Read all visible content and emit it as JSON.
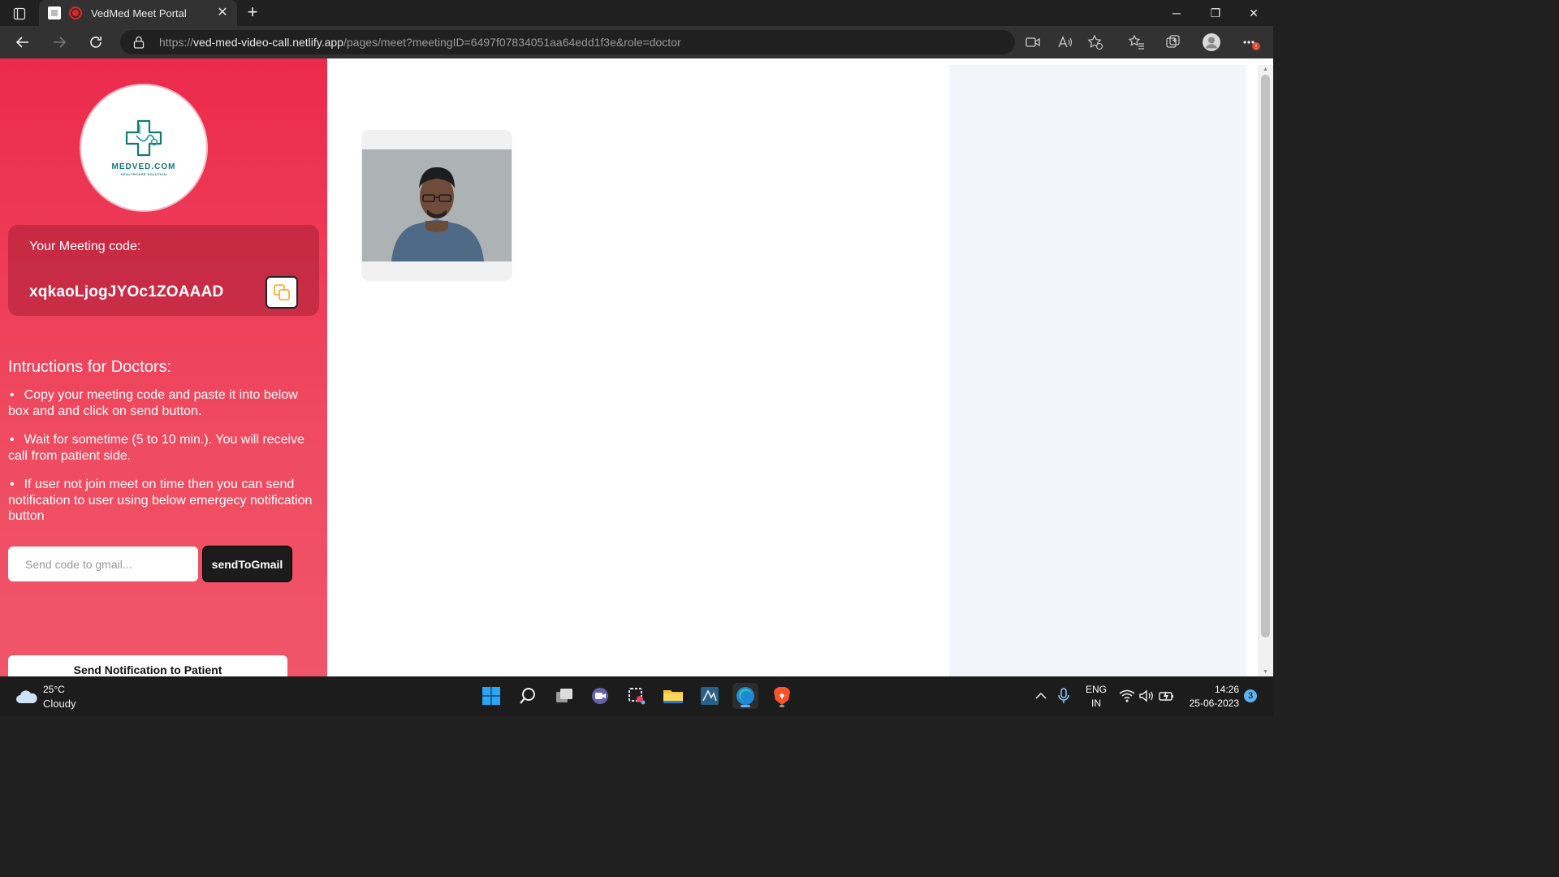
{
  "browser": {
    "tab_title": "VedMed Meet Portal",
    "url_prefix": "https://",
    "url_host": "ved-med-video-call.netlify.app",
    "url_path": "/pages/meet?meetingID=6497f07834051aa64edd1f3e&role=doctor"
  },
  "logo": {
    "name": "MEDVED.COM",
    "tagline": "HEALTHCARE SOLUTION"
  },
  "meeting": {
    "code_label": "Your Meeting code:",
    "code": "xqkaoLjogJYOc1ZOAAAD"
  },
  "instructions": {
    "title": "Intructions for Doctors:",
    "items": [
      "Copy your meeting code and paste it into below box and and click on send button.",
      "Wait for sometime (5 to 10 min.). You will receive call from patient side.",
      "If user not join meet on time then you can send notification to user using below emergecy notification button"
    ]
  },
  "send_form": {
    "placeholder": "Send code to gmail...",
    "button_label": "sendToGmail"
  },
  "notify_button": "Send Notification to Patient",
  "taskbar": {
    "weather_temp": "25°C",
    "weather_desc": "Cloudy",
    "lang": "ENG",
    "region": "IN",
    "time": "14:26",
    "date": "25-06-2023",
    "notification_count": "3"
  },
  "colors": {
    "sidebar_accent": "#ec2a4c",
    "logo_teal": "#117a72",
    "copy_icon": "#f5a623"
  }
}
